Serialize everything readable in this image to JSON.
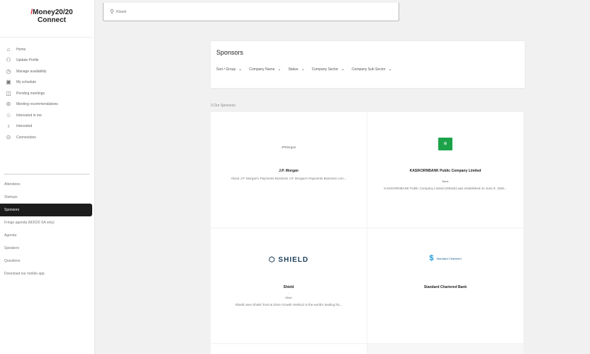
{
  "brand": {
    "logo_line1": "Money20/20",
    "logo_slash": "/",
    "logo_line2": "Connect"
  },
  "sidebar": {
    "icon_items": [
      {
        "label": "Home",
        "icon": "home-icon"
      },
      {
        "label": "Update Profile",
        "icon": "user-icon"
      },
      {
        "label": "Manage availability",
        "icon": "clock-icon"
      },
      {
        "label": "My schedule",
        "icon": "calendar-icon"
      },
      {
        "label": "Pending meetings",
        "icon": "pending-icon"
      },
      {
        "label": "Meeting recommendations",
        "icon": "recommend-icon"
      },
      {
        "label": "Interested in me",
        "icon": "interested-icon"
      },
      {
        "label": "Interested",
        "icon": "thumb-icon"
      },
      {
        "label": "Connections",
        "icon": "connections-icon"
      }
    ],
    "plain_items": [
      {
        "label": "Attendees",
        "active": false
      },
      {
        "label": "Startups",
        "active": false
      },
      {
        "label": "Sponsors",
        "active": true
      },
      {
        "label": "Fringe agenda (M2020 SA only)",
        "active": false
      },
      {
        "label": "Agenda",
        "active": false
      },
      {
        "label": "Speakers",
        "active": false
      },
      {
        "label": "Questions",
        "active": false
      },
      {
        "label": "Download our mobile app",
        "active": false
      }
    ]
  },
  "search": {
    "value": "Kbank"
  },
  "main": {
    "title": "Sponsors",
    "filters": [
      "Sort / Group",
      "Company Name",
      "Status",
      "Company Sector",
      "Company Sub Sector"
    ],
    "count": "3 Our Sponsors"
  },
  "sponsors": [
    {
      "logo_text": "JPMorgan",
      "name": "J.P. Morgan",
      "desc": "About J.P. Morgan's Payments Business J.P. Morgan's Payments Business com..."
    },
    {
      "logo_text": "KBank",
      "name": "KASIKORNBANK Public Company Limited",
      "sub1": "-",
      "sub2": "Bank",
      "desc": "KASIKORNBANK Public Company Limited (KBank) was established on June 8, 1945..."
    },
    {
      "logo_text": "SHIELD",
      "name": "Shield",
      "sub1": "-",
      "sub2": "Other",
      "desc": "Shield uses Shield Trust & Drive Growth SHIELD is the world's leading fra..."
    },
    {
      "logo_text": "Standard Chartered",
      "name": "Standard Chartered Bank"
    }
  ],
  "colors": {
    "accent_red": "#e0192b",
    "active_nav": "#1c1c1c",
    "kbank_green": "#1ca34a",
    "scb_blue": "#1b9ad6"
  }
}
